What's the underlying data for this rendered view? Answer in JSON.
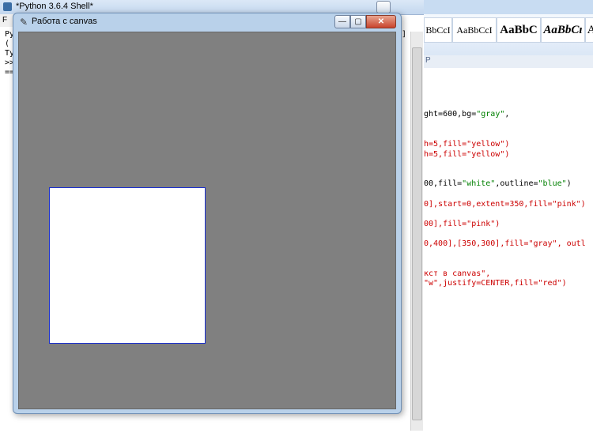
{
  "word": {
    "styles": [
      {
        "text": "BbCcI",
        "weight": "normal",
        "italic": false
      },
      {
        "text": "AaBbCcI",
        "weight": "normal",
        "italic": false
      },
      {
        "text": "AaBbC",
        "weight": "bold",
        "italic": false
      },
      {
        "text": "AaBbCı",
        "weight": "bold",
        "italic": true
      },
      {
        "text": "A",
        "weight": "normal",
        "italic": false
      }
    ],
    "ruler_mark": "P",
    "code_lines": [
      [
        {
          "t": "ght=600,bg=",
          "c": "blk"
        },
        {
          "t": "\"gray\"",
          "c": "grn"
        },
        {
          "t": ",",
          "c": "blk"
        }
      ],
      [
        {
          "t": "h=5,fill=\"yellow\")",
          "c": "red"
        }
      ],
      [
        {
          "t": "h=5,fill=\"yellow\")",
          "c": "red"
        }
      ],
      [
        {
          "t": "00,fill=",
          "c": "blk"
        },
        {
          "t": "\"white\"",
          "c": "grn"
        },
        {
          "t": ",outline=",
          "c": "blk"
        },
        {
          "t": "\"blue\"",
          "c": "grn"
        },
        {
          "t": ")",
          "c": "blk"
        }
      ],
      [
        {
          "t": "0],start=0,extent=350,fill=\"pink\")",
          "c": "red"
        }
      ],
      [
        {
          "t": "00],fill=\"pink\")",
          "c": "red"
        }
      ],
      [
        {
          "t": "0,400],[350,300],fill=\"gray\", outl",
          "c": "red"
        }
      ],
      [
        {
          "t": "кст в canvas\",",
          "c": "red"
        }
      ],
      [
        {
          "t": "\"w\",justify=CENTER,fill=\"red\")",
          "c": "red"
        }
      ]
    ]
  },
  "shell": {
    "title": "*Python 3.6.4 Shell*",
    "left_glyphs": [
      "Py",
      "(",
      "Ty",
      ">>",
      "=="
    ],
    "bracket": "]"
  },
  "canvas_window": {
    "title": "Работа с canvas",
    "minimize_glyph": "—",
    "maximize_glyph": "▢",
    "close_glyph": "✕",
    "canvas_bg": "#808080",
    "rect_fill": "#ffffff",
    "rect_outline": "#1a2fd0"
  }
}
